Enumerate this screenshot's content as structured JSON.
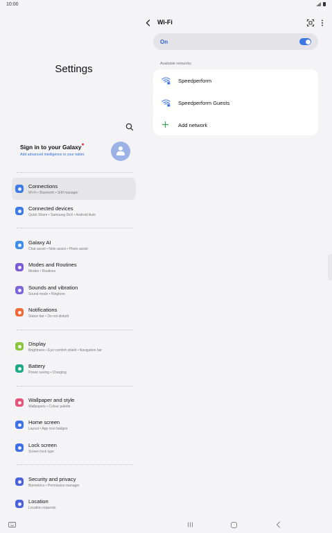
{
  "status_bar": {
    "time": "10:00"
  },
  "left_panel": {
    "title": "Settings",
    "account": {
      "title": "Sign in to your Galaxy",
      "subtitle": "Add advanced intelligence to your tablet."
    },
    "items": [
      {
        "title": "Connections",
        "subtitle": "Wi-Fi • Bluetooth • SIM manager",
        "icon": "wifi-icon",
        "color": "#3f7ae6"
      },
      {
        "title": "Connected devices",
        "subtitle": "Quick Share • Samsung DeX • Android Auto",
        "icon": "devices-icon",
        "color": "#3f7ae6"
      },
      {
        "title": "Galaxy AI",
        "subtitle": "Chat assist • Note assist • Photo assist",
        "icon": "sparkle-icon",
        "color": "#3f8ee8"
      },
      {
        "title": "Modes and Routines",
        "subtitle": "Modes • Routines",
        "icon": "check-circle-icon",
        "color": "#7b5bd6"
      },
      {
        "title": "Sounds and vibration",
        "subtitle": "Sound mode • Ringtone",
        "icon": "speaker-icon",
        "color": "#7c66d9"
      },
      {
        "title": "Notifications",
        "subtitle": "Status bar • Do not disturb",
        "icon": "bell-icon",
        "color": "#ef6a38"
      },
      {
        "title": "Display",
        "subtitle": "Brightness • Eye comfort shield • Navigation bar",
        "icon": "sun-icon",
        "color": "#8bc53f"
      },
      {
        "title": "Battery",
        "subtitle": "Power saving • Charging",
        "icon": "battery-icon",
        "color": "#1fa786"
      },
      {
        "title": "Wallpaper and style",
        "subtitle": "Wallpapers • Colour palette",
        "icon": "image-icon",
        "color": "#e4527a"
      },
      {
        "title": "Home screen",
        "subtitle": "Layout • App icon badges",
        "icon": "home-icon",
        "color": "#3f72e6"
      },
      {
        "title": "Lock screen",
        "subtitle": "Screen lock type",
        "icon": "lock-icon",
        "color": "#3d6fe3"
      },
      {
        "title": "Security and privacy",
        "subtitle": "Biometrics • Permission manager",
        "icon": "shield-icon",
        "color": "#4c62d8"
      },
      {
        "title": "Location",
        "subtitle": "Location requests",
        "icon": "location-pin-icon",
        "color": "#4c62d8"
      }
    ]
  },
  "wifi_panel": {
    "title": "Wi-Fi",
    "toggle_label": "On",
    "toggle_on": true,
    "available_label": "Available networks",
    "networks": [
      {
        "name": "Speedperform",
        "icon": "wifi-lock-icon"
      },
      {
        "name": "Speedperform Guests",
        "icon": "wifi-lock-icon"
      }
    ],
    "add_network_label": "Add network"
  },
  "colors": {
    "accent": "#3e76e6",
    "background": "#f4f4f6",
    "selected_row": "#e6e6e8"
  }
}
